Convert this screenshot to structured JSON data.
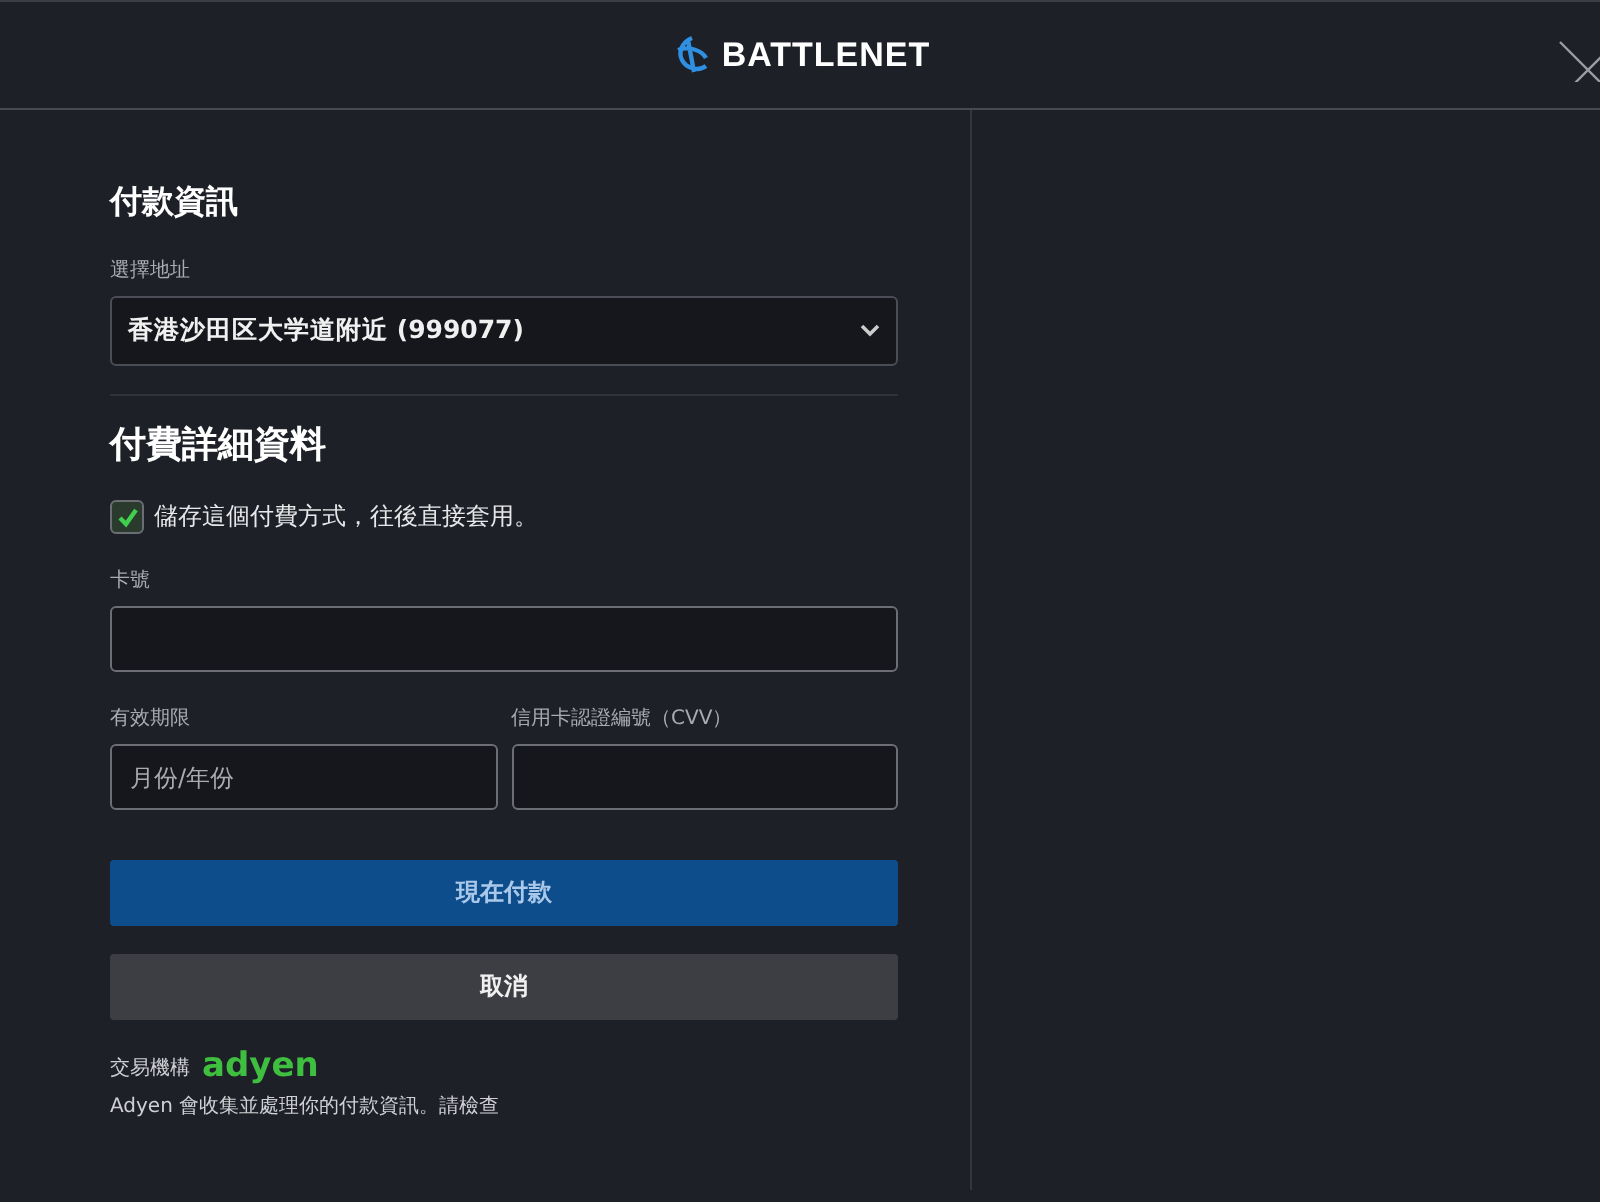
{
  "header": {
    "logo_text": "BATTLENET"
  },
  "payment_info": {
    "title": "付款資訊",
    "address_label": "選擇地址",
    "address_value": "香港沙田区大学道附近 (999077)"
  },
  "payment_details": {
    "title": "付費詳細資料",
    "save_method": {
      "label": "儲存這個付費方式，往後直接套用。",
      "checked": true
    },
    "card_number": {
      "label": "卡號"
    },
    "expiry": {
      "label": "有效期限",
      "placeholder": "月份/年份"
    },
    "cvv": {
      "label": "信用卡認證編號（CVV）"
    }
  },
  "buttons": [
    {
      "label": "現在付款",
      "kind": "primary"
    },
    {
      "label": "取消",
      "kind": "secondary"
    }
  ],
  "footer": {
    "processor_label": "交易機構",
    "processor_logo": "adyen",
    "notice": "Adyen 會收集並處理你的付款資訊。請檢查"
  }
}
